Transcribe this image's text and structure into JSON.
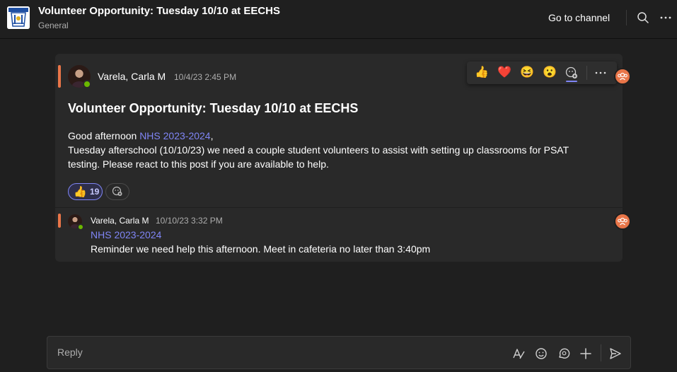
{
  "header": {
    "title": "Volunteer Opportunity: Tuesday 10/10 at EECHS",
    "channel": "General",
    "go_to_channel": "Go to channel"
  },
  "post": {
    "author": "Varela, Carla M",
    "timestamp": "10/4/23 2:45 PM",
    "subject": "Volunteer Opportunity: Tuesday 10/10 at EECHS",
    "greeting": "Good afternoon ",
    "mention": "NHS 2023-2024",
    "greeting_suffix": ",",
    "body": "Tuesday afterschool (10/10/23) we need a couple student volunteers to assist with setting up classrooms for PSAT testing. Please react to this post if you are available to help.",
    "reactions": [
      {
        "emoji": "👍",
        "icon": "thumbs-up",
        "count": "19"
      }
    ]
  },
  "reaction_bar": {
    "emojis": [
      {
        "icon": "like",
        "glyph": "👍"
      },
      {
        "icon": "heart",
        "glyph": "❤️"
      },
      {
        "icon": "laugh",
        "glyph": "😆"
      },
      {
        "icon": "surprised",
        "glyph": "😮"
      }
    ]
  },
  "reply": {
    "author": "Varela, Carla M",
    "timestamp": "10/10/23 3:32 PM",
    "mention": "NHS 2023-2024",
    "text": "Reminder we need help this afternoon. Meet in cafeteria no later than 3:40pm"
  },
  "composer": {
    "placeholder": "Reply"
  },
  "colors": {
    "accent": "#7f85f5",
    "team_badge": "#e97548",
    "presence": "#6bb700",
    "background": "#1f1f1f",
    "card": "#292929"
  }
}
